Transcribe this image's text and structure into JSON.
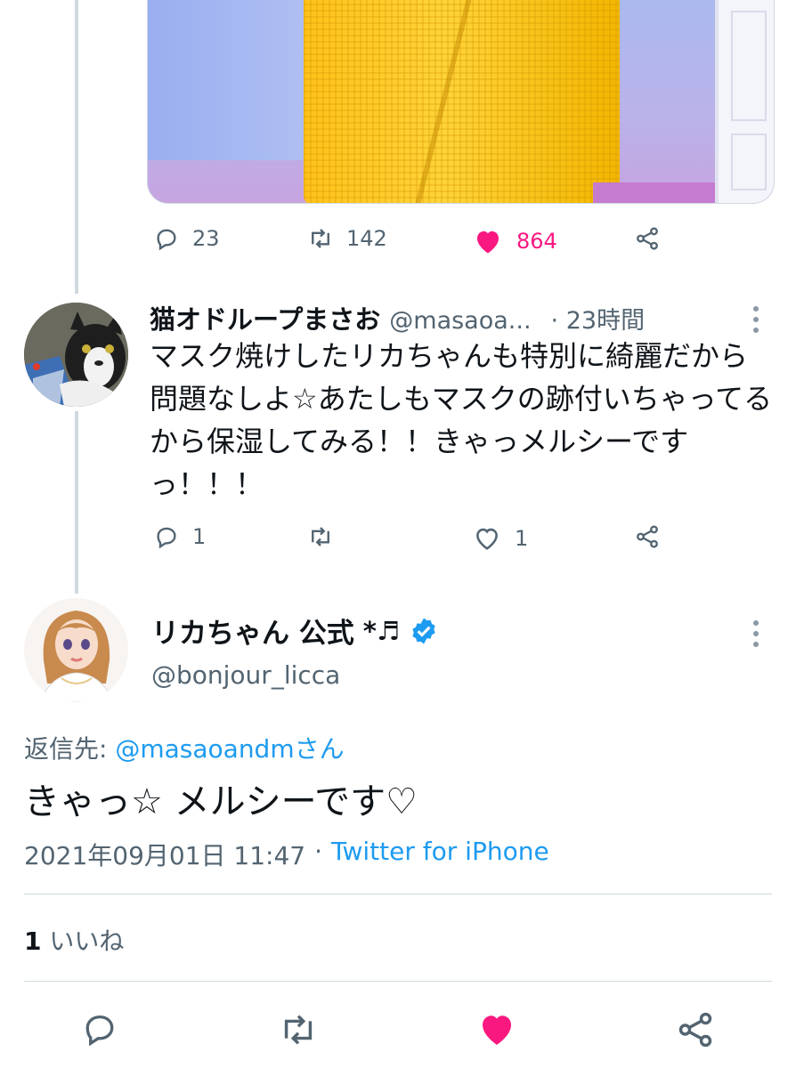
{
  "parent_tweet": {
    "media_description_icon": "photo-media",
    "actions": {
      "reply_count": "23",
      "retweet_count": "142",
      "like_count": "864"
    }
  },
  "reply_tweet": {
    "display_name": "猫オドループまさお",
    "handle": "@masaoa...",
    "time": "· 23時間",
    "text": "マスク焼けしたリカちゃんも特別に綺麗だから問題なしよ☆あたしもマスクの跡付いちゃってるから保湿してみる！！きゃっメルシーですっ！！！",
    "actions": {
      "reply_count": "1",
      "retweet_count": "",
      "like_count": "1"
    }
  },
  "main_tweet": {
    "display_name": "リカちゃん 公式",
    "name_suffix": "*♬",
    "handle": "@bonjour_licca",
    "reply_to_label": "返信先:",
    "reply_to_handle": "@masaoandmさん",
    "text": "きゃっ☆ メルシーです♡",
    "timestamp": "2021年09月01日 11:47",
    "separator": "·",
    "source": "Twitter for iPhone",
    "likes_count": "1",
    "likes_label": "いいね"
  },
  "colors": {
    "accent_blue": "#1d9bf0",
    "like_pink": "#f91880",
    "muted_gray": "#536471"
  }
}
